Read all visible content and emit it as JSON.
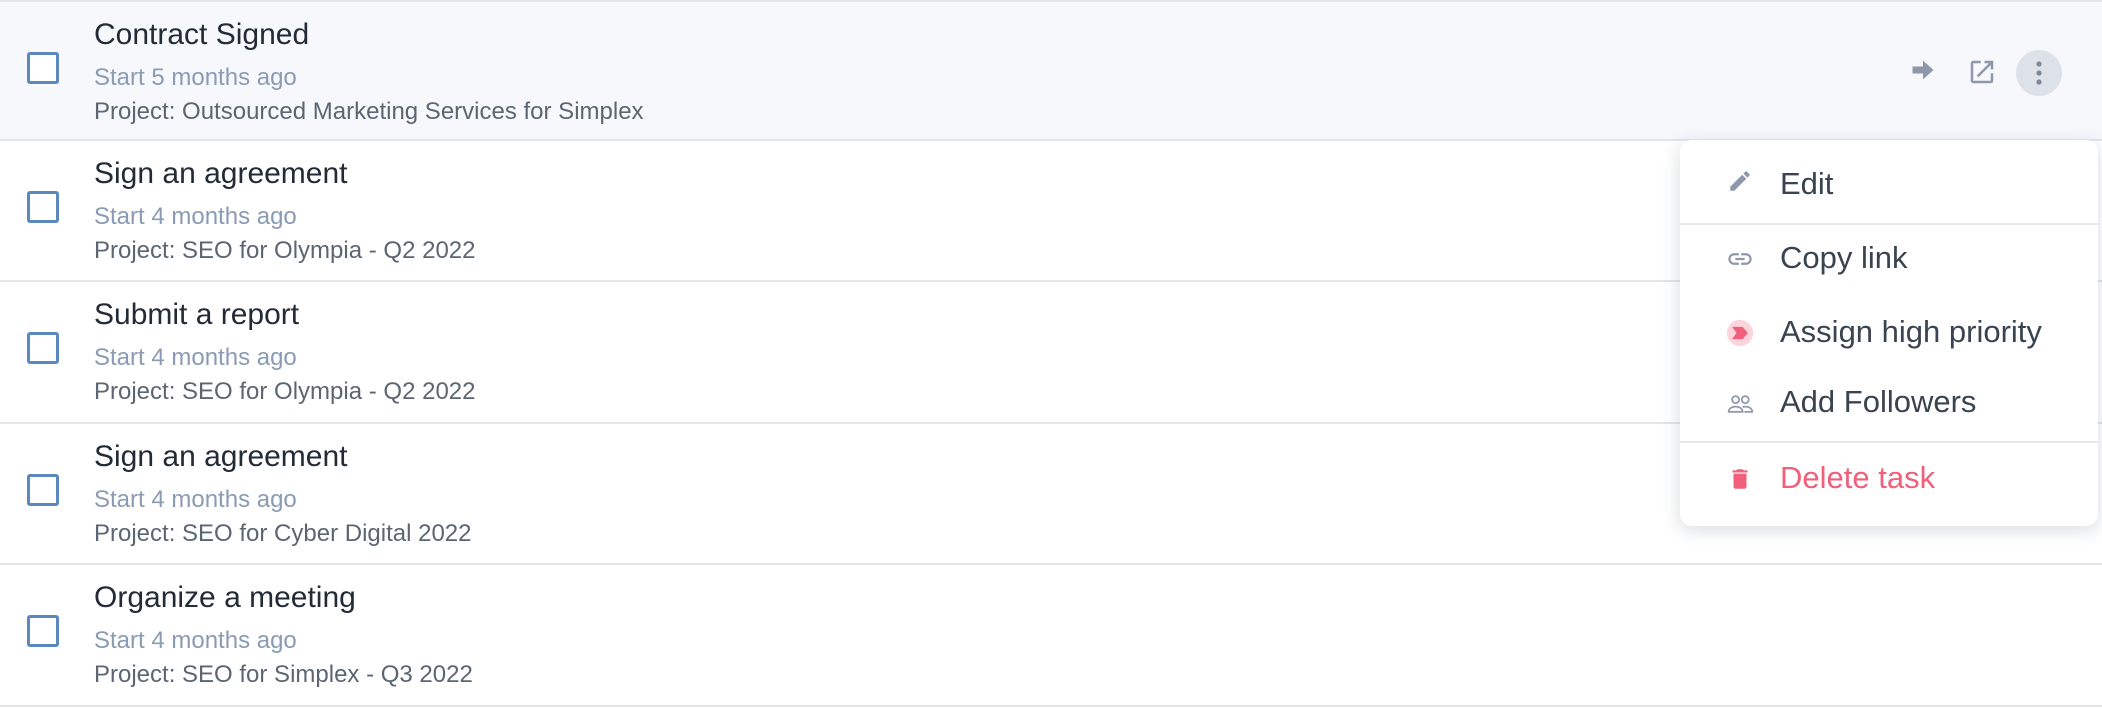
{
  "tasks": [
    {
      "title": "Contract Signed",
      "start": "Start 5 months ago",
      "project": "Project: Outsourced Marketing Services for Simplex",
      "active": true
    },
    {
      "title": "Sign an agreement",
      "start": "Start 4 months ago",
      "project": "Project: SEO for Olympia - Q2 2022",
      "active": false
    },
    {
      "title": "Submit a report",
      "start": "Start 4 months ago",
      "project": "Project: SEO for Olympia - Q2 2022",
      "active": false
    },
    {
      "title": "Sign an agreement",
      "start": "Start 4 months ago",
      "project": "Project: SEO for Cyber Digital 2022",
      "active": false
    },
    {
      "title": "Organize a meeting",
      "start": "Start 4 months ago",
      "project": "Project: SEO for Simplex - Q3 2022",
      "active": false
    }
  ],
  "row_actions": {
    "icons": [
      "arrow-right-icon",
      "open-in-new-icon",
      "more-vertical-icon"
    ]
  },
  "menu": {
    "items": [
      {
        "label": "Edit",
        "icon": "pencil-icon"
      },
      {
        "label": "Copy link",
        "icon": "link-icon"
      },
      {
        "label": "Assign high priority",
        "icon": "priority-flag-icon"
      },
      {
        "label": "Add Followers",
        "icon": "followers-icon"
      },
      {
        "label": "Delete task",
        "icon": "trash-icon"
      }
    ]
  },
  "colors": {
    "checkbox_border": "#5b88be",
    "muted_text": "#8a9bb4",
    "icon_gray": "#8d99aa",
    "danger": "#f0607a",
    "priority_bg": "#fdd4dc",
    "active_row_bg": "#f6f8fc"
  }
}
